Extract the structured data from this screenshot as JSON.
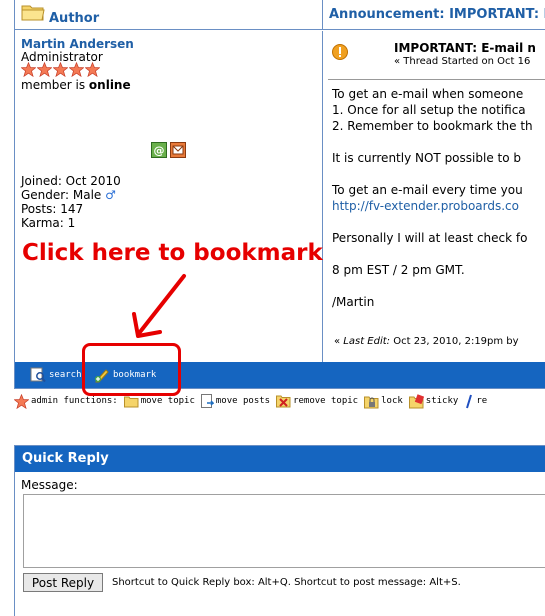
{
  "header": {
    "author_label": "Author",
    "topic": "Announcement: IMPORTANT: E"
  },
  "author": {
    "name": "Martin Andersen",
    "role": "Administrator",
    "stars": 5,
    "status_prefix": "member is ",
    "status": "online",
    "joined": "Joined: Oct 2010",
    "gender_label": "Gender: Male",
    "gender_symbol": "♂",
    "posts": "Posts: 147",
    "karma": "Karma: 1"
  },
  "post": {
    "title": "IMPORTANT: E-mail n",
    "thread_started": "« Thread Started on Oct 16",
    "lines": [
      "To get an e-mail when someone",
      "1. Once for all setup the notifica",
      "2. Remember to bookmark the th"
    ],
    "para2": "It is currently NOT possible to b",
    "para3": "To get an e-mail every time you",
    "link": "http://fv-extender.proboards.co",
    "para4": "Personally I will at least check fo",
    "para5": "8 pm EST / 2 pm GMT.",
    "signature": "/Martin",
    "last_edit_prefix": "« ",
    "last_edit_label": "Last Edit:",
    "last_edit_value": " Oct 23, 2010, 2:19pm by"
  },
  "toolbar": {
    "search": "search",
    "bookmark": "bookmark"
  },
  "admin": {
    "admin_functions": "admin functions:",
    "move_topic": "move topic",
    "move_posts": "move posts",
    "remove_topic": "remove topic",
    "lock": "lock",
    "sticky": "sticky",
    "re": "re"
  },
  "annotation": {
    "callout": "Click here to bookmark"
  },
  "quick_reply": {
    "title": "Quick Reply",
    "message_label": "Message:",
    "message_value": "",
    "post_button": "Post Reply",
    "hint": "Shortcut to Quick Reply box: Alt+Q. Shortcut to post message: Alt+S."
  },
  "colors": {
    "accent_blue": "#1565c0",
    "link_blue": "#1f5fa6",
    "annotation_red": "#e60000"
  }
}
